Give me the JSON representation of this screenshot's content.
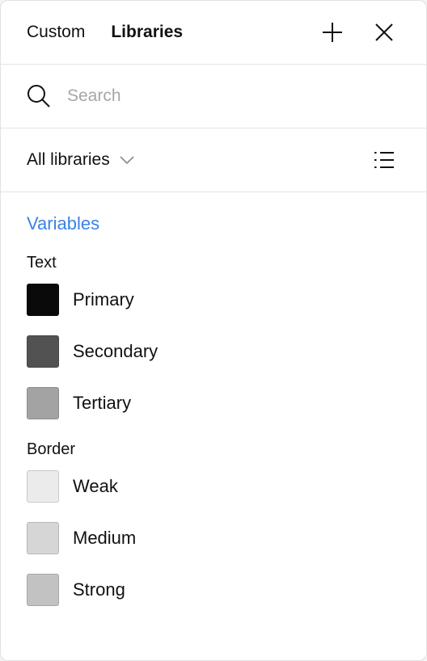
{
  "header": {
    "tabs": [
      {
        "label": "Custom",
        "active": false
      },
      {
        "label": "Libraries",
        "active": true
      }
    ],
    "add_icon": "plus-icon",
    "close_icon": "close-icon"
  },
  "search": {
    "placeholder": "Search",
    "value": "",
    "icon": "search-icon"
  },
  "filter": {
    "selected": "All libraries",
    "dropdown_icon": "chevron-down-icon",
    "view_icon": "list-view-icon"
  },
  "variables": {
    "title": "Variables",
    "accent_color": "#3b82e6",
    "groups": [
      {
        "name": "Text",
        "items": [
          {
            "label": "Primary",
            "color": "#0a0a0a"
          },
          {
            "label": "Secondary",
            "color": "#525252"
          },
          {
            "label": "Tertiary",
            "color": "#a3a3a3"
          }
        ]
      },
      {
        "name": "Border",
        "items": [
          {
            "label": "Weak",
            "color": "#ebebeb"
          },
          {
            "label": "Medium",
            "color": "#d6d6d6"
          },
          {
            "label": "Strong",
            "color": "#c2c2c2"
          }
        ]
      }
    ]
  }
}
